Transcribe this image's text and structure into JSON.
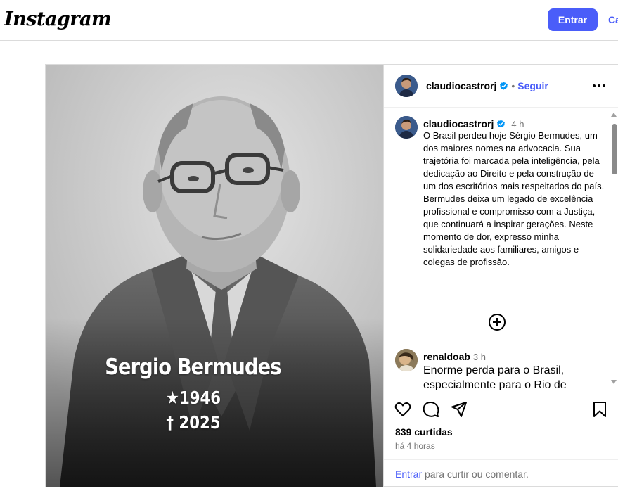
{
  "header": {
    "logo": "Instagram",
    "login_button": "Entrar",
    "signup_link": "Ca"
  },
  "photo": {
    "name": "Sergio Bermudes",
    "birth": "★1946",
    "death": "† 2025"
  },
  "post_header": {
    "username": "claudiocastrorj",
    "separator": "•",
    "follow": "Seguir"
  },
  "caption": {
    "username": "claudiocastrorj",
    "time": "4 h",
    "text": "O Brasil perdeu hoje Sérgio Bermudes, um dos maiores nomes na advocacia. Sua trajetória foi marcada pela inteligência, pela dedicação ao Direito e pela construção de um dos escritórios mais respeitados do país. Bermudes deixa um legado de excelência profissional e compromisso com a Justiça, que continuará a inspirar gerações. Neste momento de dor, expresso minha solidariedade aos familiares, amigos e colegas de profissão."
  },
  "comment": {
    "username": "renaldoab",
    "time": "3 h",
    "text": "Enorme perda para o Brasil, especialmente para o Rio de"
  },
  "stats": {
    "likes": "839 curtidas",
    "posted": "há 4 horas"
  },
  "login_prompt": {
    "link": "Entrar",
    "rest": " para curtir ou comentar."
  },
  "colors": {
    "accent": "#4a5df9",
    "verified": "#0095f6",
    "muted": "#737373"
  },
  "icons": [
    "verified-icon",
    "more-icon",
    "plus-circle-icon",
    "heart-icon",
    "comment-icon",
    "share-icon",
    "bookmark-icon"
  ]
}
